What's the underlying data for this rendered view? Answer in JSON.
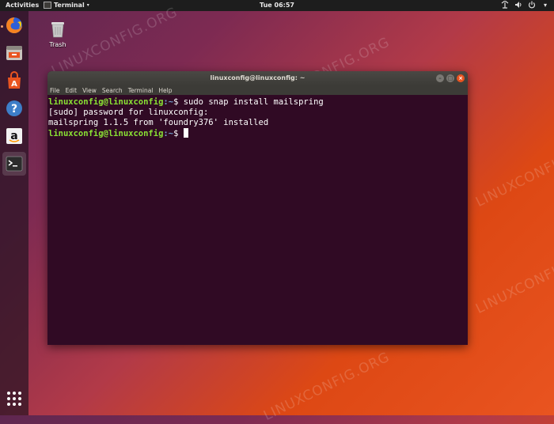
{
  "topbar": {
    "activities": "Activities",
    "app_menu": "Terminal",
    "clock": "Tue 06:57",
    "tray_icons": [
      "network-icon",
      "volume-icon",
      "power-icon",
      "chevron-down-icon"
    ]
  },
  "dock": {
    "items": [
      "firefox-icon",
      "files-icon",
      "software-center-icon",
      "help-icon",
      "amazon-icon",
      "terminal-icon"
    ],
    "show_apps_icon": "apps-grid-icon"
  },
  "desktop": {
    "trash_label": "Trash",
    "watermark": "LINUXCONFIG.ORG"
  },
  "window": {
    "title": "linuxconfig@linuxconfig: ~",
    "menu": [
      "File",
      "Edit",
      "View",
      "Search",
      "Terminal",
      "Help"
    ],
    "lines": [
      {
        "user": "linuxconfig@linuxconfig",
        "path": ":~",
        "cmd": "$ sudo snap install mailspring"
      },
      {
        "text": "[sudo] password for linuxconfig:"
      },
      {
        "text": "mailspring 1.1.5 from 'foundry376' installed"
      },
      {
        "user": "linuxconfig@linuxconfig",
        "path": ":~",
        "cmd": "$ "
      }
    ]
  },
  "colors": {
    "terminal_bg": "#300a24",
    "prompt_user": "#8ae234",
    "prompt_path": "#729fcf",
    "accent": "#e95420"
  }
}
